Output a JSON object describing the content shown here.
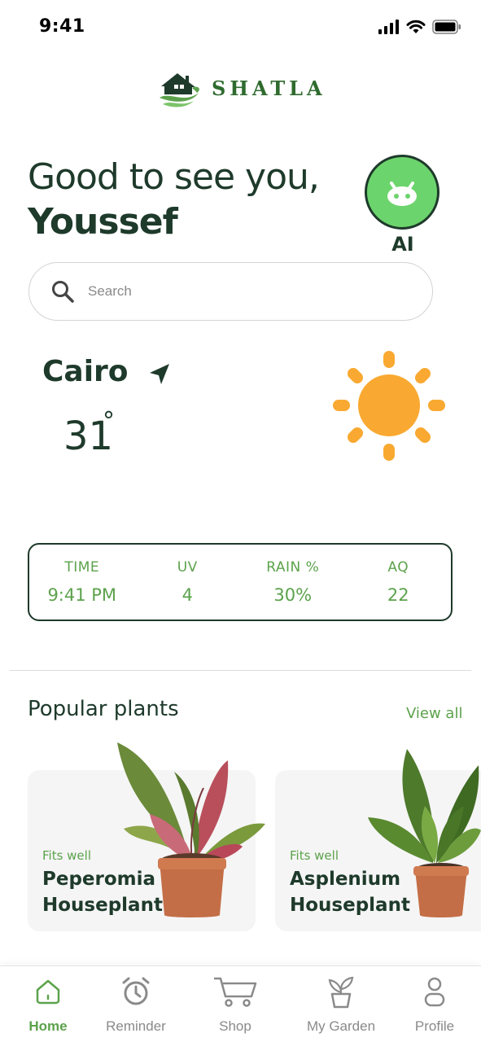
{
  "status_bar": {
    "time": "9:41"
  },
  "brand": {
    "name": "SHATLA"
  },
  "greeting": {
    "line1": "Good to see you,",
    "name": "Youssef"
  },
  "ai_button": {
    "label": "AI"
  },
  "search": {
    "placeholder": "Search"
  },
  "weather": {
    "city": "Cairo",
    "temperature": "31",
    "degree_symbol": "°",
    "stats": [
      {
        "label": "TIME",
        "value": "9:41 PM"
      },
      {
        "label": "UV",
        "value": "4"
      },
      {
        "label": "RAIN %",
        "value": "30%"
      },
      {
        "label": "AQ",
        "value": "22"
      }
    ]
  },
  "popular": {
    "title": "Popular plants",
    "view_all": "View all",
    "plants": [
      {
        "tag": "Fits well",
        "name": "Peperomia Houseplant"
      },
      {
        "tag": "Fits well",
        "name": "Asplenium Houseplant"
      }
    ]
  },
  "nav": {
    "items": [
      {
        "label": "Home",
        "icon": "home-icon",
        "active": true
      },
      {
        "label": "Reminder",
        "icon": "alarm-clock-icon"
      },
      {
        "label": "Shop",
        "icon": "cart-icon"
      },
      {
        "label": "My Garden",
        "icon": "plant-pot-icon"
      },
      {
        "label": "Profile",
        "icon": "user-icon"
      }
    ]
  },
  "colors": {
    "accent": "#5ca24c",
    "primary_text": "#1e3a2b",
    "sun": "#f9a931",
    "ai_bg": "#6cd46c"
  }
}
